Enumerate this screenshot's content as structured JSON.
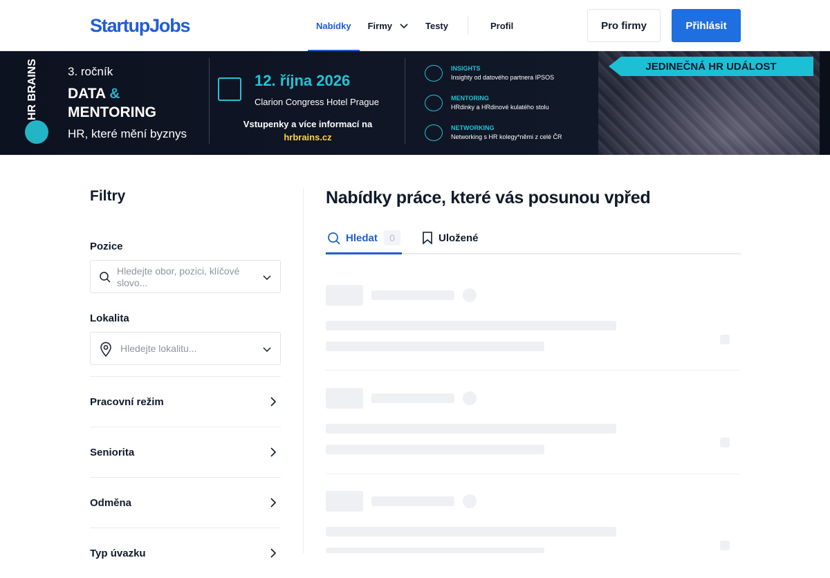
{
  "header": {
    "logo": "StartupJobs",
    "nav": [
      {
        "label": "Nabídky",
        "active": true
      },
      {
        "label": "Firmy",
        "has_dropdown": true
      },
      {
        "label": "Testy"
      },
      {
        "label": "Profil"
      }
    ],
    "for_companies_label": "Pro firmy",
    "login_label": "Přihlásit"
  },
  "banner": {
    "brand_vertical": "HR BRAINS",
    "edition": "3. ročník",
    "line1": "DATA",
    "amp": "&",
    "line2": "MENTORING",
    "tagline": "HR, které mění byznys",
    "date": "12. října 2026",
    "venue": "Clarion Congress Hotel Prague",
    "cta": "Vstupenky a více informací na",
    "cta_url": "hrbrains.cz",
    "ribbon": "JEDINEČNÁ HR UDÁLOST",
    "features": [
      {
        "title": "INSIGHTS",
        "text": "Insighty od datového partnera IPSOS"
      },
      {
        "title": "MENTORING",
        "text": "HRdinky a HRdinové kulatého stolu"
      },
      {
        "title": "NETWORKING",
        "text": "Networking s HR kolegy*němi z celé ČR"
      }
    ]
  },
  "filters": {
    "title": "Filtry",
    "position_label": "Pozice",
    "position_placeholder": "Hledejte obor, pozici, klíčové slovo...",
    "location_label": "Lokalita",
    "location_placeholder": "Hledejte lokalitu...",
    "accordions": [
      "Pracovní režim",
      "Seniorita",
      "Odměna",
      "Typ úvazku"
    ]
  },
  "main": {
    "title": "Nabídky práce, které vás posunou vpřed",
    "tab_search_label": "Hledat",
    "tab_search_count": "0",
    "tab_saved_label": "Uložené"
  },
  "colors": {
    "brand_blue": "#1f5dd6",
    "button_blue": "#1f6fe0",
    "banner_accent": "#23c3d6"
  }
}
